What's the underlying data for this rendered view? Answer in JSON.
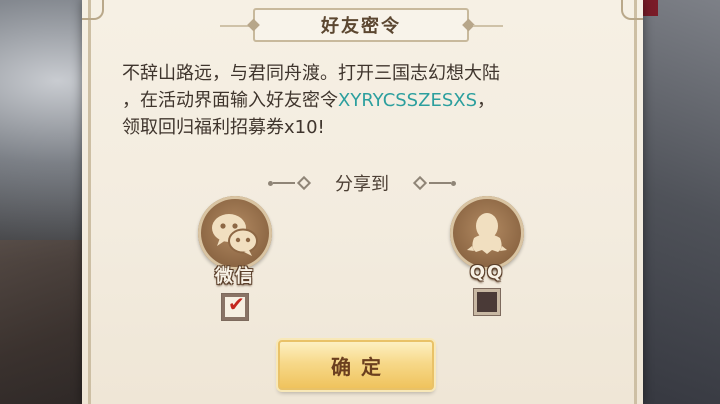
{
  "dialog": {
    "title": "好友密令",
    "message_lines": [
      "不辞山路远，与君同舟渡。打开三国志幻想大陆",
      "，在活动界面输入好友密令",
      "，",
      "领取回归福利招募券x10!"
    ],
    "invite_code": "XYRYCSSZESXS",
    "share_label": "分享到",
    "options": [
      {
        "label": "微信",
        "icon": "wechat-icon",
        "checked": true
      },
      {
        "label": "QQ",
        "icon": "qq-icon",
        "checked": false
      }
    ],
    "confirm_label": "确定"
  },
  "colors": {
    "code": "#2c9f9e",
    "panel": "#f3ecdf",
    "icon_circle": "#8d6744",
    "button": "#f7d98a",
    "check": "#c4271e"
  }
}
